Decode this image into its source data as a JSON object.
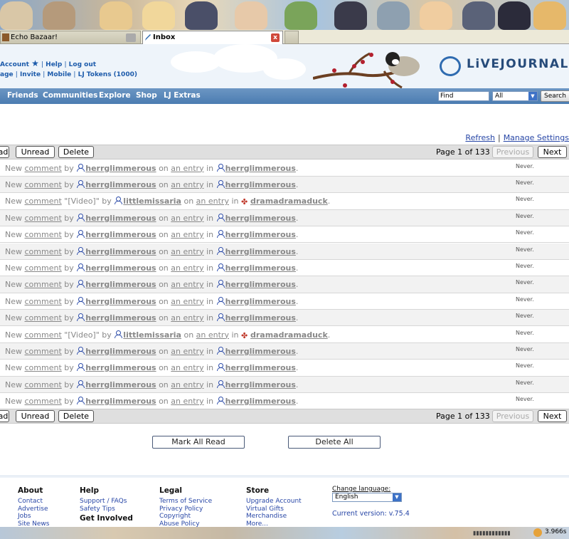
{
  "browser": {
    "tabs": [
      {
        "label": "Echo Bazaar!"
      },
      {
        "label": "Inbox"
      }
    ],
    "close_glyph": "x"
  },
  "account": {
    "line1": [
      "Account",
      "Help",
      "Log out"
    ],
    "line2": [
      "age",
      "Invite",
      "Mobile",
      "LJ Tokens (1000)"
    ]
  },
  "logo": {
    "text": "LiVEJOURNAL",
    "tm": "™"
  },
  "nav": {
    "items": [
      "Friends",
      "Communities",
      "Explore",
      "Shop",
      "LJ Extras"
    ],
    "search_placeholder": "Find",
    "search_scope": "All",
    "search_button": "Search"
  },
  "inbox": {
    "refresh_label": "Refresh",
    "manage_label": "Manage Settings",
    "action_bar": {
      "read_label": "ad",
      "unread_label": "Unread",
      "delete_label": "Delete",
      "page_info": "Page 1 of 133",
      "previous_label": "Previous",
      "next_label": "Next"
    },
    "rows": [
      {
        "type": "user",
        "prefix": "New",
        "comment": "comment",
        "extra": "",
        "by": "by",
        "author": "herrglimmerous",
        "on": "on",
        "entry": "an entry",
        "in": "in",
        "journal": "herrglimmerous",
        "journal_type": "user",
        "when": "Never."
      },
      {
        "type": "user",
        "prefix": "New",
        "comment": "comment",
        "extra": "",
        "by": "by",
        "author": "herrglimmerous",
        "on": "on",
        "entry": "an entry",
        "in": "in",
        "journal": "herrglimmerous",
        "journal_type": "user",
        "when": "Never."
      },
      {
        "type": "user",
        "prefix": "New",
        "comment": "comment",
        "extra": "\"[Video]\"",
        "by": "by",
        "author": "littlemissaria",
        "on": "on",
        "entry": "an entry",
        "in": "in",
        "journal": "dramadramaduck",
        "journal_type": "community",
        "when": "Never."
      },
      {
        "type": "user",
        "prefix": "New",
        "comment": "comment",
        "extra": "",
        "by": "by",
        "author": "herrglimmerous",
        "on": "on",
        "entry": "an entry",
        "in": "in",
        "journal": "herrglimmerous",
        "journal_type": "user",
        "when": "Never."
      },
      {
        "type": "user",
        "prefix": "New",
        "comment": "comment",
        "extra": "",
        "by": "by",
        "author": "herrglimmerous",
        "on": "on",
        "entry": "an entry",
        "in": "in",
        "journal": "herrglimmerous",
        "journal_type": "user",
        "when": "Never."
      },
      {
        "type": "user",
        "prefix": "New",
        "comment": "comment",
        "extra": "",
        "by": "by",
        "author": "herrglimmerous",
        "on": "on",
        "entry": "an entry",
        "in": "in",
        "journal": "herrglimmerous",
        "journal_type": "user",
        "when": "Never."
      },
      {
        "type": "user",
        "prefix": "New",
        "comment": "comment",
        "extra": "",
        "by": "by",
        "author": "herrglimmerous",
        "on": "on",
        "entry": "an entry",
        "in": "in",
        "journal": "herrglimmerous",
        "journal_type": "user",
        "when": "Never."
      },
      {
        "type": "user",
        "prefix": "New",
        "comment": "comment",
        "extra": "",
        "by": "by",
        "author": "herrglimmerous",
        "on": "on",
        "entry": "an entry",
        "in": "in",
        "journal": "herrglimmerous",
        "journal_type": "user",
        "when": "Never."
      },
      {
        "type": "user",
        "prefix": "New",
        "comment": "comment",
        "extra": "",
        "by": "by",
        "author": "herrglimmerous",
        "on": "on",
        "entry": "an entry",
        "in": "in",
        "journal": "herrglimmerous",
        "journal_type": "user",
        "when": "Never."
      },
      {
        "type": "user",
        "prefix": "New",
        "comment": "comment",
        "extra": "",
        "by": "by",
        "author": "herrglimmerous",
        "on": "on",
        "entry": "an entry",
        "in": "in",
        "journal": "herrglimmerous",
        "journal_type": "user",
        "when": "Never."
      },
      {
        "type": "user",
        "prefix": "New",
        "comment": "comment",
        "extra": "\"[Video]\"",
        "by": "by",
        "author": "littlemissaria",
        "on": "on",
        "entry": "an entry",
        "in": "in",
        "journal": "dramadramaduck",
        "journal_type": "community",
        "when": "Never."
      },
      {
        "type": "user",
        "prefix": "New",
        "comment": "comment",
        "extra": "",
        "by": "by",
        "author": "herrglimmerous",
        "on": "on",
        "entry": "an entry",
        "in": "in",
        "journal": "herrglimmerous",
        "journal_type": "user",
        "when": "Never."
      },
      {
        "type": "user",
        "prefix": "New",
        "comment": "comment",
        "extra": "",
        "by": "by",
        "author": "herrglimmerous",
        "on": "on",
        "entry": "an entry",
        "in": "in",
        "journal": "herrglimmerous",
        "journal_type": "user",
        "when": "Never."
      },
      {
        "type": "user",
        "prefix": "New",
        "comment": "comment",
        "extra": "",
        "by": "by",
        "author": "herrglimmerous",
        "on": "on",
        "entry": "an entry",
        "in": "in",
        "journal": "herrglimmerous",
        "journal_type": "user",
        "when": "Never."
      },
      {
        "type": "user",
        "prefix": "New",
        "comment": "comment",
        "extra": "",
        "by": "by",
        "author": "herrglimmerous",
        "on": "on",
        "entry": "an entry",
        "in": "in",
        "journal": "herrglimmerous",
        "journal_type": "user",
        "when": "Never."
      }
    ],
    "mark_all_read": "Mark All Read",
    "delete_all": "Delete All"
  },
  "footer": {
    "about": {
      "title": "About",
      "links": [
        "Contact",
        "Advertise",
        "Jobs",
        "Site News"
      ]
    },
    "help": {
      "title": "Help",
      "links": [
        "Support / FAQs",
        "Safety Tips"
      ],
      "sub": "Get Involved"
    },
    "legal": {
      "title": "Legal",
      "links": [
        "Terms of Service",
        "Privacy Policy",
        "Copyright",
        "Abuse Policy"
      ]
    },
    "store": {
      "title": "Store",
      "links": [
        "Upgrade Account",
        "Virtual Gifts",
        "Merchandise",
        "More..."
      ]
    },
    "language_label": "Change language:",
    "language_value": "English",
    "version": "Current version: v.75.4"
  },
  "status": {
    "timer": "3.966s"
  },
  "colors": {
    "link": "#2746a6",
    "nav": "#4b7cb1",
    "accent": "#2f6bb0"
  }
}
